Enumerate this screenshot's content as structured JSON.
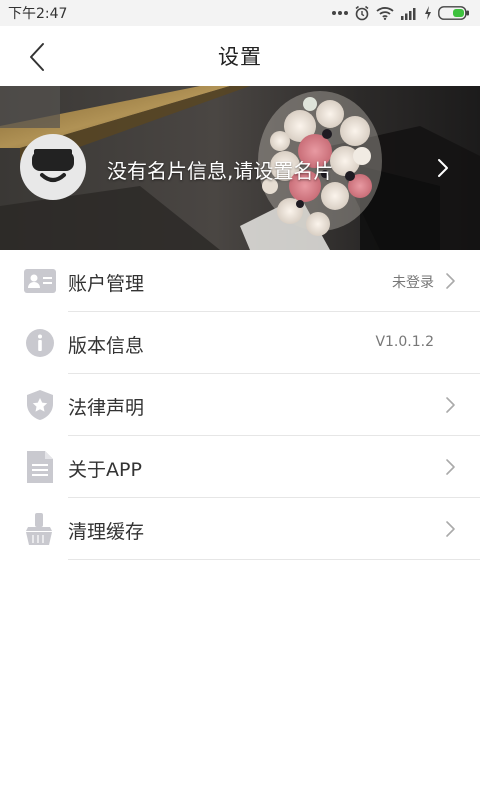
{
  "status_bar": {
    "time": "下午2:47",
    "icons": [
      "more-dots-icon",
      "alarm-icon",
      "wifi-icon",
      "signal-icon",
      "charging-icon",
      "battery-icon"
    ]
  },
  "header": {
    "title": "设置",
    "back_icon": "chevron-left-icon"
  },
  "banner": {
    "text": "没有名片信息,请设置名片",
    "avatar_icon": "sunglasses-face-icon",
    "chevron_icon": "chevron-right-icon"
  },
  "menu": {
    "items": [
      {
        "label": "账户管理",
        "value": "未登录",
        "icon": "id-card-icon",
        "has_chevron": true
      },
      {
        "label": "版本信息",
        "value": "V1.0.1.2",
        "icon": "info-icon",
        "has_chevron": false
      },
      {
        "label": "法律声明",
        "value": "",
        "icon": "shield-star-icon",
        "has_chevron": true
      },
      {
        "label": "关于APP",
        "value": "",
        "icon": "document-icon",
        "has_chevron": true
      },
      {
        "label": "清理缓存",
        "value": "",
        "icon": "brush-icon",
        "has_chevron": true
      }
    ]
  },
  "colors": {
    "background": "#ffffff",
    "status_bar": "#f3f3f3",
    "icon_gray": "#c9c9cf",
    "divider": "#e6e6e6",
    "battery_green": "#3ec13e"
  }
}
